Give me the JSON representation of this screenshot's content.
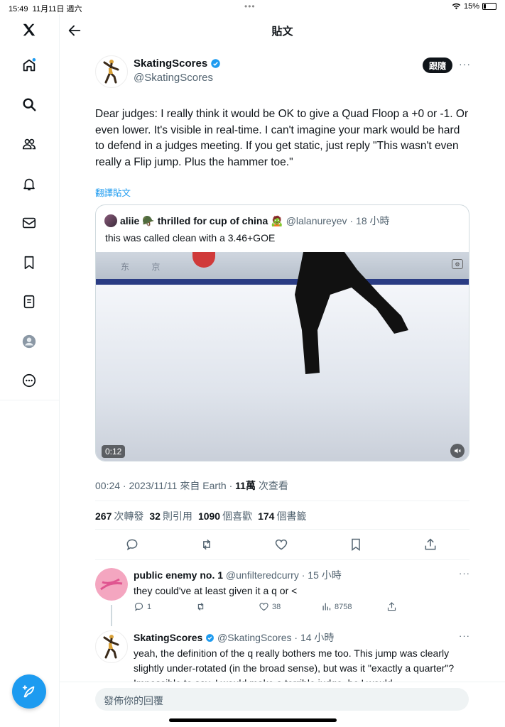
{
  "status": {
    "time": "15:49",
    "date": "11月11日 週六",
    "battery": "15%"
  },
  "header": {
    "title": "貼文"
  },
  "sidebar": {
    "items": [
      "x-logo",
      "home",
      "search",
      "communities",
      "notifications",
      "messages",
      "bookmarks",
      "lists",
      "profile",
      "more"
    ]
  },
  "tweet": {
    "name": "SkatingScores",
    "handle": "@SkatingScores",
    "follow_label": "跟隨",
    "text": "Dear judges: I really think it would be OK to give a Quad Floop a +0 or -1. Or even lower. It's visible in real-time. I can't imagine your mark would be hard to defend in a judges meeting. If you get static, just reply \"This wasn't even really a Flip jump. Plus the hammer toe.\"",
    "translate": "翻譯貼文",
    "quote": {
      "name": "aliie",
      "name_suffix": "thrilled for cup of china",
      "handle": "@lalanureyev",
      "time": "· 18 小時",
      "text": "this was called clean with a 3.46+GOE",
      "video_time": "0:12",
      "board_text": "东 京"
    },
    "meta_prefix": "00:24 · 2023/11/11 來自 Earth · ",
    "views": "11萬",
    "views_label": " 次查看",
    "stats": {
      "retweets": "267",
      "retweets_label": "次轉發",
      "quotes": "32",
      "quotes_label": "則引用",
      "likes": "1090",
      "likes_label": "個喜歡",
      "bookmarks": "174",
      "bookmarks_label": "個書籤"
    }
  },
  "replies": [
    {
      "name": "public enemy no. 1",
      "handle": "@unfilteredcurry",
      "time": "· 15 小時",
      "text": "they could've at least given it a q or <",
      "reply_count": "1",
      "like_count": "38",
      "view_count": "8758"
    },
    {
      "name": "SkatingScores",
      "handle": "@SkatingScores",
      "time": "· 14 小時",
      "text": "yeah, the definition of the q really bothers me too. This jump was clearly slightly under-rotated (in the broad sense), but was it \"exactly a quarter\"? Impossible to say. I would make a terrible judge, bc I would"
    }
  ],
  "reply_box": {
    "placeholder": "發佈你的回覆"
  },
  "colors": {
    "accent": "#1d9bf0",
    "text": "#0f1419",
    "muted": "#536471"
  }
}
